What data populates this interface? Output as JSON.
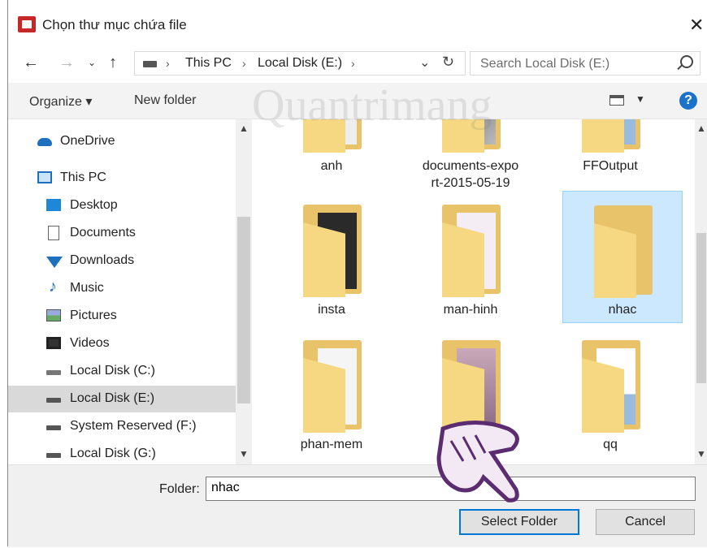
{
  "window": {
    "title": "Chọn thư mục chứa file"
  },
  "nav": {
    "breadcrumbs": [
      "This PC",
      "Local Disk (E:)"
    ],
    "search_placeholder": "Search Local Disk (E:)"
  },
  "toolbar": {
    "organize": "Organize ▾",
    "new_folder": "New folder",
    "help": "?"
  },
  "sidebar": {
    "items": [
      {
        "label": "OneDrive",
        "icon": "onedrive-icon"
      },
      {
        "label": "This PC",
        "icon": "pc-icon"
      },
      {
        "label": "Desktop",
        "icon": "desktop-icon"
      },
      {
        "label": "Documents",
        "icon": "documents-icon"
      },
      {
        "label": "Downloads",
        "icon": "downloads-icon"
      },
      {
        "label": "Music",
        "icon": "music-icon"
      },
      {
        "label": "Pictures",
        "icon": "pictures-icon"
      },
      {
        "label": "Videos",
        "icon": "videos-icon"
      },
      {
        "label": "Local Disk (C:)",
        "icon": "drive-icon"
      },
      {
        "label": "Local Disk (E:)",
        "icon": "drive-icon",
        "selected": true
      },
      {
        "label": "System Reserved (F:)",
        "icon": "drive-icon"
      },
      {
        "label": "Local Disk (G:)",
        "icon": "drive-icon"
      }
    ]
  },
  "folders": [
    {
      "name": "anh"
    },
    {
      "name_line1": "documents-expo",
      "name_line2": "rt-2015-05-19"
    },
    {
      "name": "FFOutput"
    },
    {
      "name": "insta"
    },
    {
      "name": "man-hinh"
    },
    {
      "name": "nhac",
      "selected": true
    },
    {
      "name": "phan-mem"
    },
    {
      "name": ""
    },
    {
      "name": "qq"
    }
  ],
  "bottom": {
    "folder_label": "Folder:",
    "folder_value": "nhac",
    "select_button": "Select Folder",
    "cancel_button": "Cancel"
  },
  "watermark": "Quantrimang",
  "colors": {
    "accent": "#0078d7",
    "selection": "#cce8ff",
    "folder": "#f5d881"
  }
}
